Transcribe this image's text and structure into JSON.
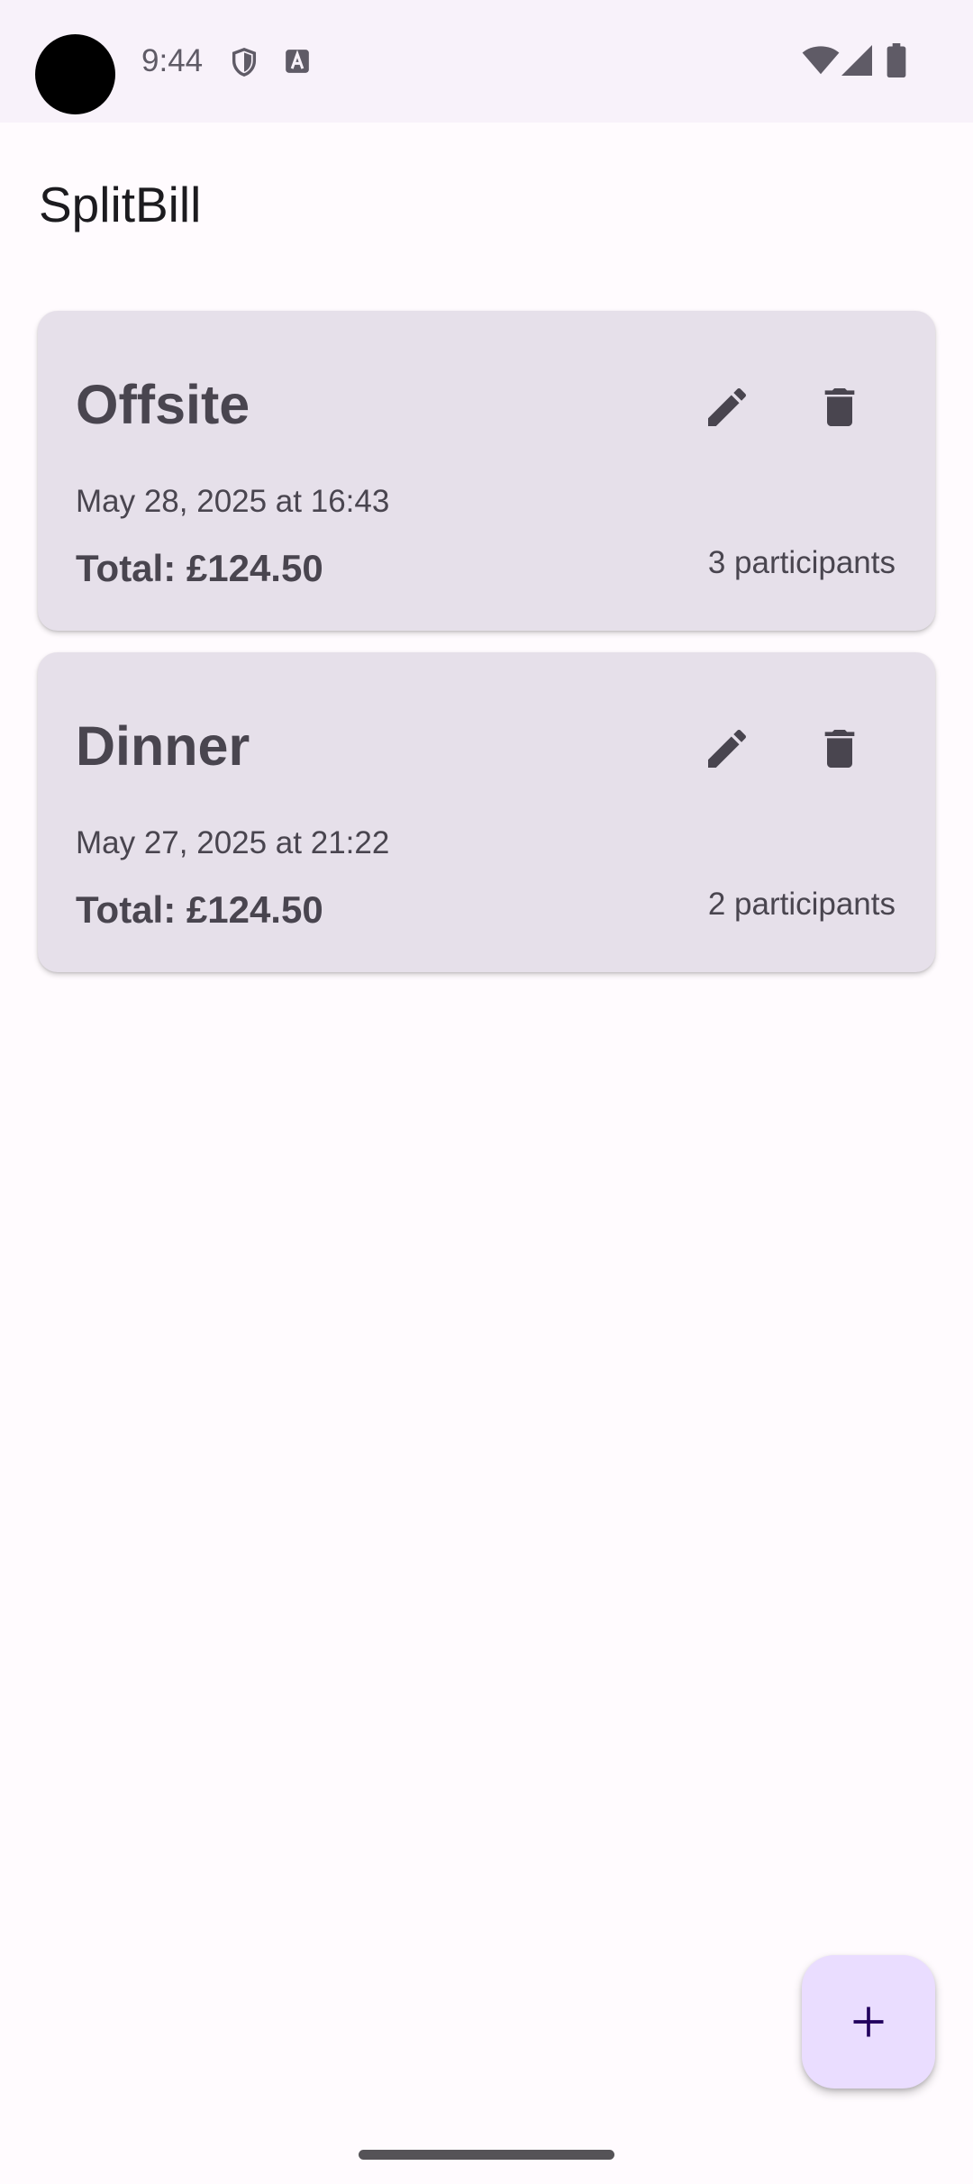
{
  "status_bar": {
    "time": "9:44",
    "icons": [
      "camera-cutout",
      "shield-icon",
      "text-a-icon",
      "wifi-icon",
      "cellular-signal-icon",
      "battery-icon"
    ]
  },
  "app_bar": {
    "title": "SplitBill"
  },
  "bills": [
    {
      "title": "Offsite",
      "date": "May 28, 2025 at 16:43",
      "total": "Total: £124.50",
      "participants": "3 participants",
      "actions": [
        "edit-icon",
        "delete-icon"
      ]
    },
    {
      "title": "Dinner",
      "date": "May 27, 2025 at 21:22",
      "total": "Total: £124.50",
      "participants": "2 participants",
      "actions": [
        "edit-icon",
        "delete-icon"
      ]
    }
  ],
  "fab": {
    "icon": "add-icon"
  },
  "colors": {
    "background": "#FFFBFE",
    "status_bar": "#F8F2FA",
    "card": "#E6E0EA",
    "card_text": "#49454F",
    "fab": "#EADDFF",
    "fab_icon": "#21005D"
  }
}
